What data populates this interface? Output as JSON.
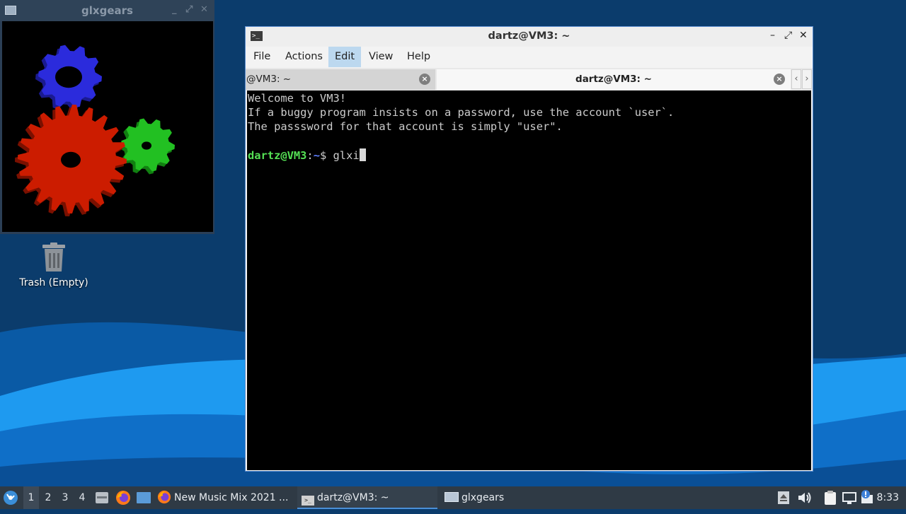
{
  "glxgears_window": {
    "title": "glxgears",
    "controls": [
      "_",
      "⤢",
      "✕"
    ]
  },
  "desktop": {
    "trash_label": "Trash (Empty)"
  },
  "terminal": {
    "title": "dartz@VM3: ~",
    "menu": [
      "File",
      "Actions",
      "Edit",
      "View",
      "Help"
    ],
    "active_menu": "Edit",
    "tabs": [
      {
        "label": "@VM3: ~",
        "active": false
      },
      {
        "label": "dartz@VM3: ~",
        "active": true
      }
    ],
    "output_lines": [
      "Welcome to VM3!",
      "If a buggy program insists on a password, use the account `user`.",
      "The passsword for that account is simply \"user\"."
    ],
    "prompt": {
      "user_host": "dartz@VM3",
      "path": "~",
      "symbol": "$",
      "command": "glxi"
    }
  },
  "taskbar": {
    "workspaces": [
      "1",
      "2",
      "3",
      "4"
    ],
    "current_workspace": "1",
    "tasks": [
      {
        "label": "New Music Mix 2021 ...",
        "icon": "firefox-icon"
      },
      {
        "label": "dartz@VM3: ~",
        "icon": "terminal-icon",
        "active": true
      },
      {
        "label": "glxgears",
        "icon": "window-icon"
      }
    ],
    "clock": "8:33"
  },
  "colors": {
    "desktop_top": "#0b3c6c",
    "wave_light": "#1ea0f0",
    "terminal_prompt_user": "#55e055",
    "terminal_prompt_path": "#5f7fff",
    "taskbar_bg": "#2f3a45"
  }
}
